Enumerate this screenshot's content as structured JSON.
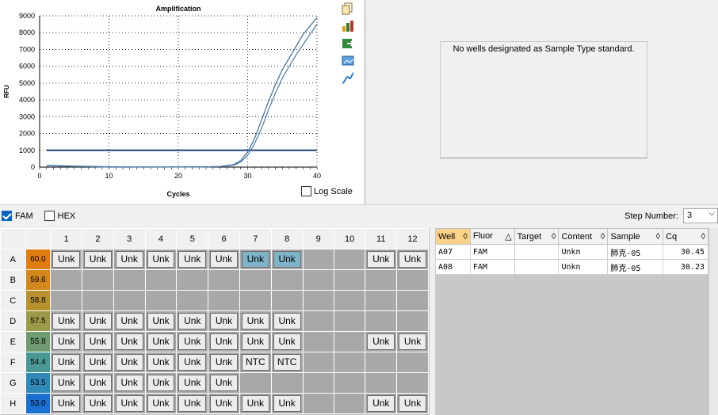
{
  "chart": {
    "title": "Amplification",
    "xlabel": "Cycles",
    "ylabel": "RFU",
    "log_scale_label": "Log Scale",
    "log_scale_checked": false
  },
  "chart_data": {
    "type": "line",
    "title": "Amplification",
    "xlabel": "Cycles",
    "ylabel": "RFU",
    "xlim": [
      0,
      40
    ],
    "ylim": [
      0,
      9000
    ],
    "xticks": [
      0,
      10,
      20,
      30,
      40
    ],
    "yticks": [
      0,
      1000,
      2000,
      3000,
      4000,
      5000,
      6000,
      7000,
      8000,
      9000
    ],
    "grid": true,
    "threshold": 1000,
    "series": [
      {
        "x": [
          1,
          5,
          10,
          15,
          20,
          24,
          26,
          28,
          29,
          30,
          31,
          32,
          33,
          34,
          35,
          36,
          37,
          38,
          39,
          40
        ],
        "y": [
          100,
          60,
          20,
          10,
          15,
          20,
          40,
          150,
          400,
          900,
          1700,
          2800,
          3900,
          4900,
          5800,
          6500,
          7200,
          7900,
          8400,
          8900
        ]
      },
      {
        "x": [
          1,
          5,
          10,
          15,
          20,
          24,
          26,
          28,
          29,
          30,
          31,
          32,
          33,
          34,
          35,
          36,
          37,
          38,
          39,
          40
        ],
        "y": [
          80,
          40,
          0,
          0,
          5,
          10,
          30,
          120,
          300,
          700,
          1400,
          2300,
          3400,
          4400,
          5300,
          6000,
          6700,
          7300,
          7900,
          8500
        ]
      }
    ]
  },
  "standard_panel": {
    "message": "No wells designated as Sample Type standard."
  },
  "fluors": [
    {
      "label": "FAM",
      "checked": true
    },
    {
      "label": "HEX",
      "checked": false
    }
  ],
  "step": {
    "label": "Step Number:",
    "value": "3"
  },
  "plate": {
    "columns": [
      "1",
      "2",
      "3",
      "4",
      "5",
      "6",
      "7",
      "8",
      "9",
      "10",
      "11",
      "12"
    ],
    "rows": [
      {
        "label": "A",
        "temp": "60.0",
        "color": "#e07b10",
        "wells": [
          "Unk",
          "Unk",
          "Unk",
          "Unk",
          "Unk",
          "Unk",
          "Unk*",
          "Unk*",
          "",
          "",
          "Unk",
          "Unk"
        ]
      },
      {
        "label": "B",
        "temp": "59.6",
        "color": "#d4881c",
        "wells": [
          "",
          "",
          "",
          "",
          "",
          "",
          "",
          "",
          "",
          "",
          "",
          ""
        ]
      },
      {
        "label": "C",
        "temp": "58.8",
        "color": "#b8912e",
        "wells": [
          "",
          "",
          "",
          "",
          "",
          "",
          "",
          "",
          "",
          "",
          "",
          ""
        ]
      },
      {
        "label": "D",
        "temp": "57.5",
        "color": "#9a9a48",
        "wells": [
          "Unk",
          "Unk",
          "Unk",
          "Unk",
          "Unk",
          "Unk",
          "Unk",
          "Unk",
          "",
          "",
          "",
          ""
        ]
      },
      {
        "label": "E",
        "temp": "55.8",
        "color": "#6e9c70",
        "wells": [
          "Unk",
          "Unk",
          "Unk",
          "Unk",
          "Unk",
          "Unk",
          "Unk",
          "Unk",
          "",
          "",
          "Unk",
          "Unk"
        ]
      },
      {
        "label": "F",
        "temp": "54.4",
        "color": "#4a9896",
        "wells": [
          "Unk",
          "Unk",
          "Unk",
          "Unk",
          "Unk",
          "Unk",
          "NTC",
          "NTC",
          "",
          "",
          "",
          ""
        ]
      },
      {
        "label": "G",
        "temp": "53.5",
        "color": "#2f8ab8",
        "wells": [
          "Unk",
          "Unk",
          "Unk",
          "Unk",
          "Unk",
          "Unk",
          "",
          "",
          "",
          "",
          "",
          ""
        ]
      },
      {
        "label": "H",
        "temp": "53.0",
        "color": "#1a6fd0",
        "wells": [
          "Unk",
          "Unk",
          "Unk",
          "Unk",
          "Unk",
          "Unk",
          "Unk",
          "Unk",
          "",
          "",
          "Unk",
          "Unk"
        ]
      }
    ]
  },
  "results": {
    "headers": [
      "Well",
      "Fluor",
      "Target",
      "Content",
      "Sample",
      "Cq"
    ],
    "rows": [
      [
        "A07",
        "FAM",
        "",
        "Unkn",
        "肺克-05",
        "30.45"
      ],
      [
        "A08",
        "FAM",
        "",
        "Unkn",
        "肺克-05",
        "30.23"
      ]
    ]
  }
}
